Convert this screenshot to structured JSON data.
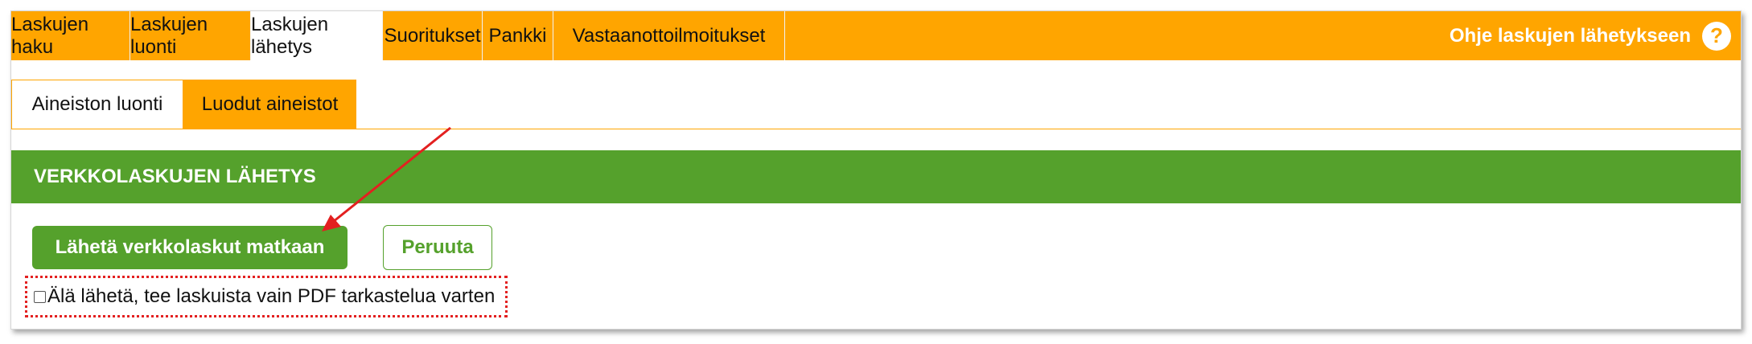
{
  "top_nav": {
    "tabs": [
      {
        "label": "Laskujen haku",
        "active": false
      },
      {
        "label": "Laskujen luonti",
        "active": false
      },
      {
        "label": "Laskujen lähetys",
        "active": true
      },
      {
        "label": "Suoritukset",
        "active": false
      },
      {
        "label": "Pankki",
        "active": false
      },
      {
        "label": "Vastaanottoilmoitukset",
        "active": false
      }
    ],
    "help_label": "Ohje laskujen lähetykseen",
    "help_icon_glyph": "?"
  },
  "sub_nav": {
    "tabs": [
      {
        "label": "Aineiston luonti",
        "active": true
      },
      {
        "label": "Luodut aineistot",
        "active": false
      }
    ]
  },
  "section": {
    "title": "VERKKOLASKUJEN LÄHETYS",
    "send_button_label": "Lähetä verkkolaskut matkaan",
    "cancel_button_label": "Peruuta",
    "checkbox_label": "Älä lähetä, tee laskuista vain PDF tarkastelua varten",
    "checkbox_checked": false
  },
  "colors": {
    "nav_orange": "#ffa500",
    "header_green": "#55a12c",
    "annotation_red": "#e32020"
  },
  "icons": {
    "help": "question-circle-icon",
    "annotation": "red-arrow-annotation"
  }
}
